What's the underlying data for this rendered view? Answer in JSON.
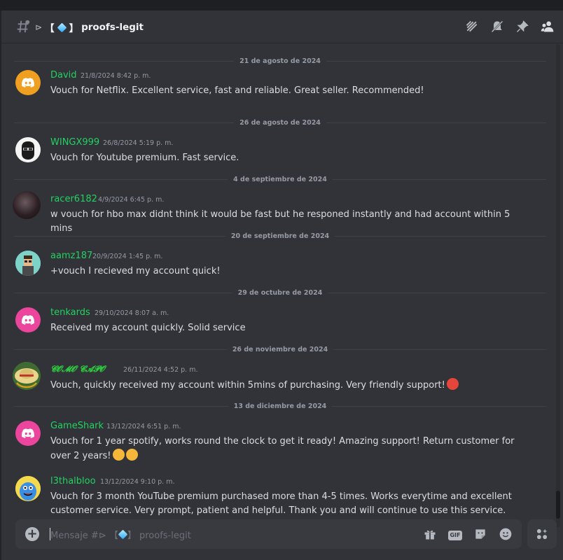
{
  "channel": {
    "name": "proofs-legit",
    "prefix_left": "【",
    "prefix_right": "】",
    "arrow": "⊳"
  },
  "dividers": [
    "21 de agosto de 2024",
    "26 de agosto de 2024",
    "4 de septiembre de 2024",
    "20 de septiembre de 2024",
    "29 de octubre de 2024",
    "26 de noviembre de 2024",
    "13 de diciembre de 2024"
  ],
  "messages": [
    {
      "user": "David",
      "timestamp": "21/8/2024 8:42 p. m.",
      "text": "Vouch for Netflix. Excellent service, fast and reliable. Great seller. Recommended!",
      "avatar": "discord-orange"
    },
    {
      "user": "WINGX999",
      "timestamp": "26/8/2024 5:19 p. m.",
      "text": "Vouch for Youtube premium. Fast service.",
      "avatar": "bearded-face"
    },
    {
      "user": "racer6182",
      "timestamp": "4/9/2024 6:45 p. m.",
      "text": "w vouch for hbo max didnt think it would be fast but he responed instantly and had account within 5 mins",
      "avatar": "dark-photo"
    },
    {
      "user": "aamz187",
      "timestamp": "20/9/2024 1:45 p. m.",
      "text": "+vouch I recieved my account quick!",
      "avatar": "pixel-character"
    },
    {
      "user": "tenkards",
      "timestamp": "29/10/2024 8:07 a. m.",
      "text": "Received my account quickly. Solid service",
      "avatar": "discord-pink"
    },
    {
      "user": "𝓒𝓞𝓜𝓞 𝓒𝓐𝓟𝓞",
      "timestamp": "26/11/2024 4:52 p. m.",
      "text": "Vouch, quickly received my account within 5mins of purchasing. Very friendly support!",
      "avatar": "straw-hat"
    },
    {
      "user": "GameShark",
      "timestamp": "13/12/2024 6:51 p. m.",
      "text": "Vouch for 1 year spotify, works round the clock to get it ready! Amazing support! Return customer for over 2 years!",
      "avatar": "discord-pink"
    },
    {
      "user": "l3thalbloo",
      "timestamp": "13/12/2024 9:10 p. m.",
      "text": "Vouch for 3 month YouTube premium purchased more than 4-5 times. Works everytime and excellent customer service. Very prompt, patient and helpful. Thank you and will continue to use this service.",
      "avatar": "blue-creature"
    }
  ],
  "composer": {
    "placeholder_prefix": "Mensaje #⊳ 【",
    "placeholder_suffix": "】 proofs-legit",
    "gif_label": "GIF",
    "plus_label": "+"
  },
  "icons": {
    "header": [
      "threads-icon",
      "mute-icon",
      "pin-icon",
      "members-icon"
    ],
    "composer": [
      "gift-icon",
      "gif-icon",
      "sticker-icon",
      "emoji-icon"
    ]
  },
  "colors": {
    "username": "#23d160",
    "background": "#313338",
    "composer": "#383a40"
  }
}
